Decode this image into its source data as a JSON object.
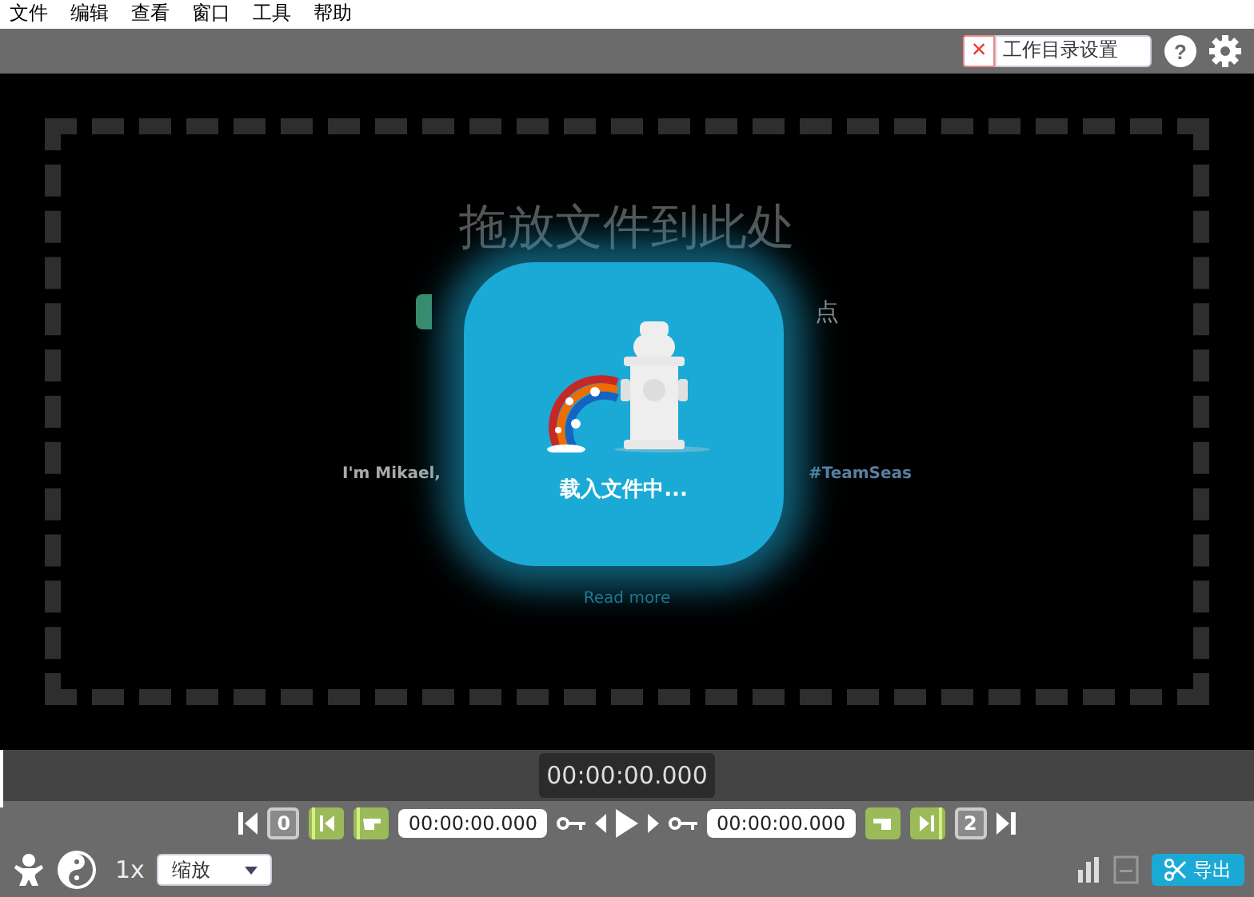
{
  "menu_bar": {
    "items": [
      "文件",
      "编辑",
      "查看",
      "窗口",
      "工具",
      "帮助"
    ]
  },
  "toolbar": {
    "clear_glyph": "×",
    "working_dir_button": "工作目录设置",
    "help_glyph": "?"
  },
  "drop_zone": {
    "title": "拖放文件到此处",
    "fragment_right": "点",
    "notice_left": "I'm Mikael,",
    "notice_right": "#TeamSeas",
    "read_more": "Read more"
  },
  "loading": {
    "message": "载入文件中..."
  },
  "timeline": {
    "current_time": "00:00:00.000"
  },
  "controls": {
    "start_segment": "0",
    "cut_start": "00:00:00.000",
    "cut_end": "00:00:00.000",
    "end_segment": "2",
    "speed": "1x",
    "zoom": {
      "value": "缩放"
    },
    "export_button": "导出"
  }
}
